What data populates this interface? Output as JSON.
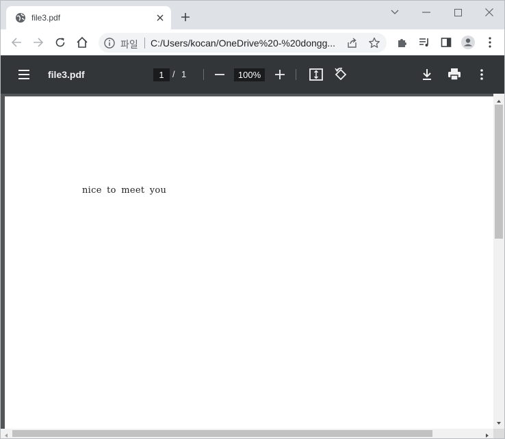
{
  "tab": {
    "title": "file3.pdf",
    "favicon": "globe-icon"
  },
  "window_controls": [
    "chevron-down-icon",
    "minimize-icon",
    "maximize-icon",
    "close-icon"
  ],
  "omnibox": {
    "scheme_label": "파일",
    "url": "C:/Users/kocan/OneDrive%20-%20dongg..."
  },
  "pdf_toolbar": {
    "filename": "file3.pdf",
    "current_page": "1",
    "page_separator": "/",
    "total_pages": "1",
    "zoom": "100%"
  },
  "document": {
    "text": "nice to meet you"
  },
  "colors": {
    "tabstrip": "#dee1e6",
    "pdf_toolbar": "#323639",
    "viewer_bg": "#525659",
    "omnibox": "#f1f3f4"
  }
}
